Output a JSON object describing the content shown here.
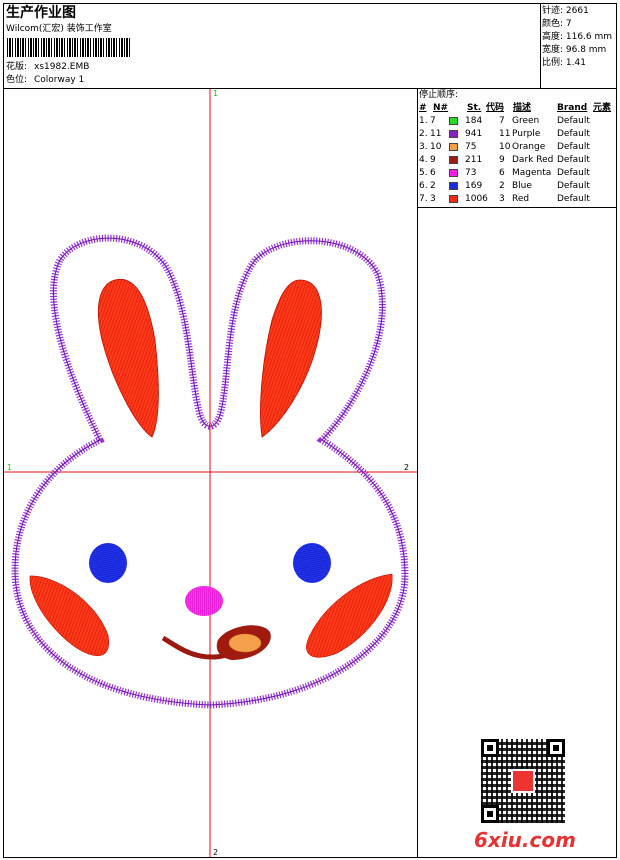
{
  "header": {
    "title": "生产作业图",
    "company": "Wilcom(汇宏) 装饰工作室",
    "design_label": "花版:",
    "design_file": "xs1982.EMB",
    "colorway_label": "色位:",
    "colorway": "Colorway 1"
  },
  "stats": {
    "stitches": "针迹: 2661",
    "colors": "颜色: 7",
    "height": "高度: 116.6 mm",
    "width": "宽度: 96.8 mm",
    "scale": "比例: 1.41"
  },
  "stop_sequence": {
    "title": "停止顺序:",
    "headers": {
      "num": "#",
      "needle": "N#",
      "stitches": "St.",
      "code": "代码",
      "desc": "描述",
      "brand": "Brand",
      "elem": "元素"
    },
    "rows": [
      {
        "idx": "1.",
        "needle": "7",
        "color": "#22dd22",
        "stitches": "184",
        "code": "7",
        "desc": "Green",
        "brand": "Default"
      },
      {
        "idx": "2.",
        "needle": "11",
        "color": "#8a1fc7",
        "stitches": "941",
        "code": "11",
        "desc": "Purple",
        "brand": "Default"
      },
      {
        "idx": "3.",
        "needle": "10",
        "color": "#f5a04a",
        "stitches": "75",
        "code": "10",
        "desc": "Orange",
        "brand": "Default"
      },
      {
        "idx": "4.",
        "needle": "9",
        "color": "#a01a10",
        "stitches": "211",
        "code": "9",
        "desc": "Dark Red",
        "brand": "Default"
      },
      {
        "idx": "5.",
        "needle": "6",
        "color": "#ff1fe0",
        "stitches": "73",
        "code": "6",
        "desc": "Magenta",
        "brand": "Default"
      },
      {
        "idx": "6.",
        "needle": "2",
        "color": "#1a2ee0",
        "stitches": "169",
        "code": "2",
        "desc": "Blue",
        "brand": "Default"
      },
      {
        "idx": "7.",
        "needle": "3",
        "color": "#f02a14",
        "stitches": "1006",
        "code": "3",
        "desc": "Red",
        "brand": "Default"
      }
    ]
  },
  "axes": {
    "top": "1",
    "bottom": "2",
    "left": "1",
    "right": "2"
  },
  "watermark": "6xiu.com"
}
